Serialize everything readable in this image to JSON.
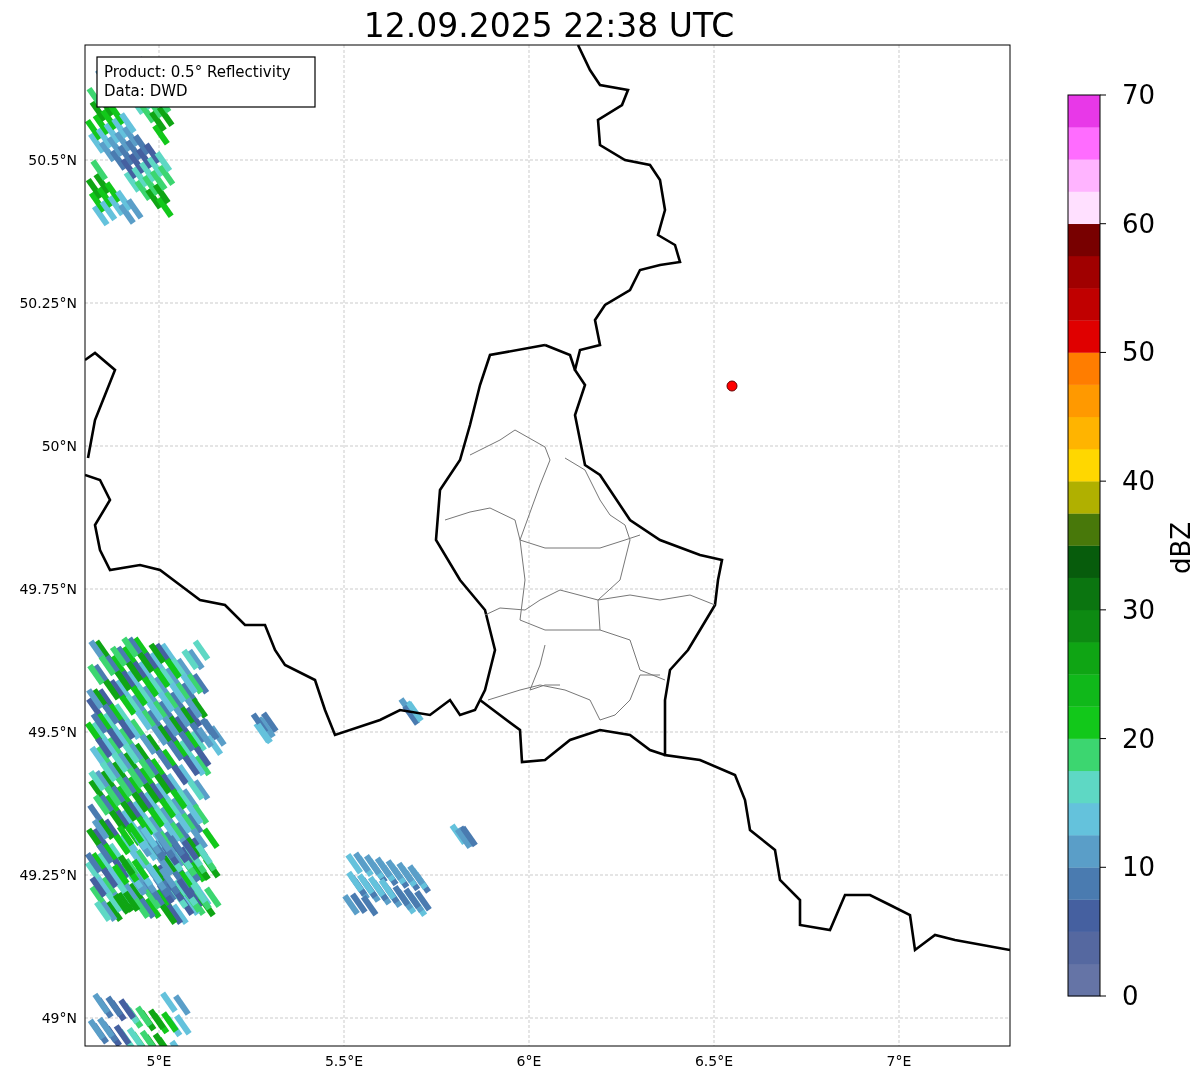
{
  "title": "12.09.2025 22:38 UTC",
  "info_box": [
    "Product: 0.5° Reflectivity",
    "Data: DWD"
  ],
  "map": {
    "yticks": [
      "50.5°N",
      "50.25°N",
      "50°N",
      "49.75°N",
      "49.5°N",
      "49.25°N",
      "49°N"
    ],
    "xticks": [
      "5°E",
      "5.5°E",
      "6°E",
      "6.5°E",
      "7°E"
    ]
  },
  "colorbar": {
    "label": "dBZ",
    "ticks": [
      "70",
      "60",
      "50",
      "40",
      "30",
      "20",
      "10",
      "0"
    ],
    "bins": [
      {
        "color": "#6574a6"
      },
      {
        "color": "#5568a0"
      },
      {
        "color": "#4560a0"
      },
      {
        "color": "#4a7bb0"
      },
      {
        "color": "#5a9ec8"
      },
      {
        "color": "#64c2dc"
      },
      {
        "color": "#5ed8c4"
      },
      {
        "color": "#3cd670"
      },
      {
        "color": "#12c81a"
      },
      {
        "color": "#10b81a"
      },
      {
        "color": "#0fa514"
      },
      {
        "color": "#0d8a12"
      },
      {
        "color": "#0b7510"
      },
      {
        "color": "#075c0c"
      },
      {
        "color": "#48780a"
      },
      {
        "color": "#b0b000"
      },
      {
        "color": "#ffd700"
      },
      {
        "color": "#ffb400"
      },
      {
        "color": "#ff9900"
      },
      {
        "color": "#ff7d00"
      },
      {
        "color": "#e00000"
      },
      {
        "color": "#c00000"
      },
      {
        "color": "#a00000"
      },
      {
        "color": "#780000"
      },
      {
        "color": "#ffe0ff"
      },
      {
        "color": "#ffb4ff"
      },
      {
        "color": "#ff6cff"
      },
      {
        "color": "#e838e8"
      }
    ]
  }
}
